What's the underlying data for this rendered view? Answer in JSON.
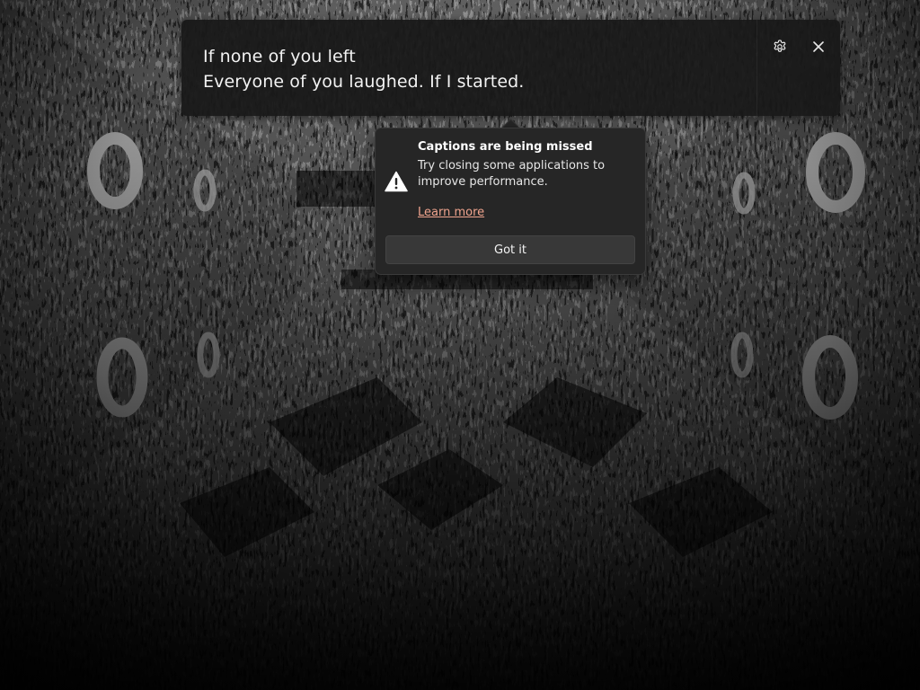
{
  "caption_window": {
    "lines": [
      "If none of you left",
      "Everyone of you laughed. If I started."
    ],
    "settings_icon": "gear-icon",
    "close_icon": "close-icon"
  },
  "warning_flyout": {
    "icon": "warning-icon",
    "title": "Captions are being missed",
    "body": "Try closing some applications to improve performance.",
    "link_label": "Learn more",
    "button_label": "Got it"
  },
  "colors": {
    "caption_bg": "#181818",
    "flyout_bg": "#262626",
    "link": "#f0a48e",
    "button_bg": "#383838"
  }
}
